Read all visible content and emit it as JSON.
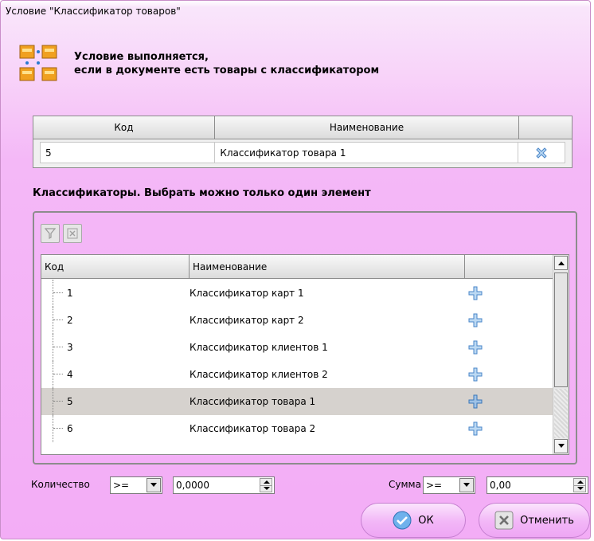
{
  "window": {
    "title": "Условие \"Классификатор товаров\""
  },
  "header": {
    "line1": "Условие выполняется,",
    "line2": "если в документе есть товары с классификатором"
  },
  "selected_table": {
    "columns": [
      "Код",
      "Наименование",
      ""
    ],
    "rows": [
      {
        "code": "5",
        "name": "Классификатор товара 1"
      }
    ]
  },
  "classifiers": {
    "title": "Классификаторы. Выбрать можно только один элемент",
    "columns": [
      "Код",
      "Наименование",
      ""
    ],
    "rows": [
      {
        "code": "1",
        "name": "Классификатор карт 1"
      },
      {
        "code": "2",
        "name": "Классификатор карт 2"
      },
      {
        "code": "3",
        "name": "Классификатор клиентов 1"
      },
      {
        "code": "4",
        "name": "Классификатор клиентов 2"
      },
      {
        "code": "5",
        "name": "Классификатор товара 1",
        "selected": true
      },
      {
        "code": "6",
        "name": "Классификатор товара 2"
      }
    ]
  },
  "filters": {
    "quantity_label": "Количество",
    "quantity_op": ">=",
    "quantity_value": "0,0000",
    "sum_label": "Сумма",
    "sum_op": ">=",
    "sum_value": "0,00"
  },
  "buttons": {
    "ok": "ОК",
    "cancel": "Отменить"
  },
  "colors": {
    "plus_icon": "#4a90d9",
    "remove_icon": "#4a90d9",
    "selected_row": "#d6d2ce"
  }
}
